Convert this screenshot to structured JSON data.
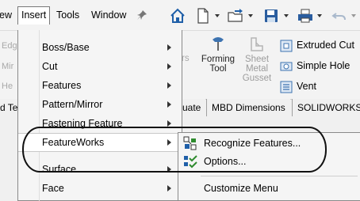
{
  "menubar": {
    "items": [
      {
        "label": "ew"
      },
      {
        "label": "Insert"
      },
      {
        "label": "Tools"
      },
      {
        "label": "Window"
      }
    ]
  },
  "ribbon": {
    "left_faded": [
      "Edg",
      "Mir",
      "He"
    ],
    "faded_rs": "rs",
    "forming_tool": {
      "label_line1": "Forming",
      "label_line2": "Tool"
    },
    "sheet_metal_gusset": {
      "line1": "Sheet",
      "line2": "Metal",
      "line3": "Gusset"
    },
    "right_buttons": [
      {
        "label": "Extruded Cut",
        "icon": "extruded-cut-icon"
      },
      {
        "label": "Simple Hole",
        "icon": "simple-hole-icon"
      },
      {
        "label": "Vent",
        "icon": "vent-icon"
      }
    ]
  },
  "tabs": {
    "partial_left": "d Te",
    "partial_mid": "uate",
    "mbd": "MBD Dimensions",
    "solidworks": "SOLIDWORKS A"
  },
  "insert_menu": {
    "items": [
      {
        "label": "Boss/Base",
        "submenu": true
      },
      {
        "label": "Cut",
        "submenu": true
      },
      {
        "label": "Features",
        "submenu": true
      },
      {
        "label": "Pattern/Mirror",
        "submenu": true
      },
      {
        "label": "Fastening Feature",
        "submenu": true
      },
      {
        "label": "FeatureWorks",
        "submenu": true
      },
      {
        "label": "Surface",
        "submenu": true
      },
      {
        "label": "Face",
        "submenu": true
      }
    ]
  },
  "featureworks_submenu": {
    "items": [
      {
        "label": "Recognize Features...",
        "icon": "recognize-features-icon"
      },
      {
        "label": "Options...",
        "icon": "options-checklist-icon"
      },
      {
        "label": "Customize Menu"
      }
    ]
  },
  "colors": {
    "accent_blue": "#1f5fa8",
    "check_green": "#2e8b2e"
  }
}
